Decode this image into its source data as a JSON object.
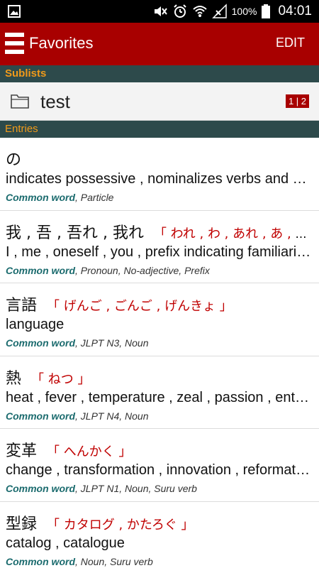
{
  "status_bar": {
    "battery": "100%",
    "time": "04:01"
  },
  "app_bar": {
    "title": "Favorites",
    "edit_label": "EDIT"
  },
  "sections": {
    "sublists_label": "Sublists",
    "entries_label": "Entries"
  },
  "sublists": [
    {
      "name": "test",
      "badge": "1 | 2"
    }
  ],
  "entries": [
    {
      "kanji": "の",
      "reading": "",
      "meaning": "indicates possessive , nominalizes verbs and adjectives",
      "common": "Common word",
      "tags": ", Particle"
    },
    {
      "kanji": "我 , 吾 , 吾れ , 我れ",
      "reading": "「 われ , わ , あれ , あ , わぬ , わろ 」",
      "meaning": "I , me , oneself , you , prefix indicating familiarity or contempt",
      "common": "Common word",
      "tags": ", Pronoun, No-adjective, Prefix"
    },
    {
      "kanji": "言語",
      "reading": "「 げんご , ごんご , げんきょ 」",
      "meaning": "language",
      "common": "Common word",
      "tags": ", JLPT N3, Noun"
    },
    {
      "kanji": "熱",
      "reading": "「 ねつ 」",
      "meaning": "heat , fever , temperature , zeal , passion , enthusiasm",
      "common": "Common word",
      "tags": ", JLPT N4, Noun"
    },
    {
      "kanji": "変革",
      "reading": "「 へんかく 」",
      "meaning": "change , transformation , innovation , reformation",
      "common": "Common word",
      "tags": ", JLPT N1, Noun, Suru verb"
    },
    {
      "kanji": "型録",
      "reading": "「 カタログ , かたろぐ 」",
      "meaning": "catalog , catalogue",
      "common": "Common word",
      "tags": ", Noun, Suru verb"
    }
  ]
}
